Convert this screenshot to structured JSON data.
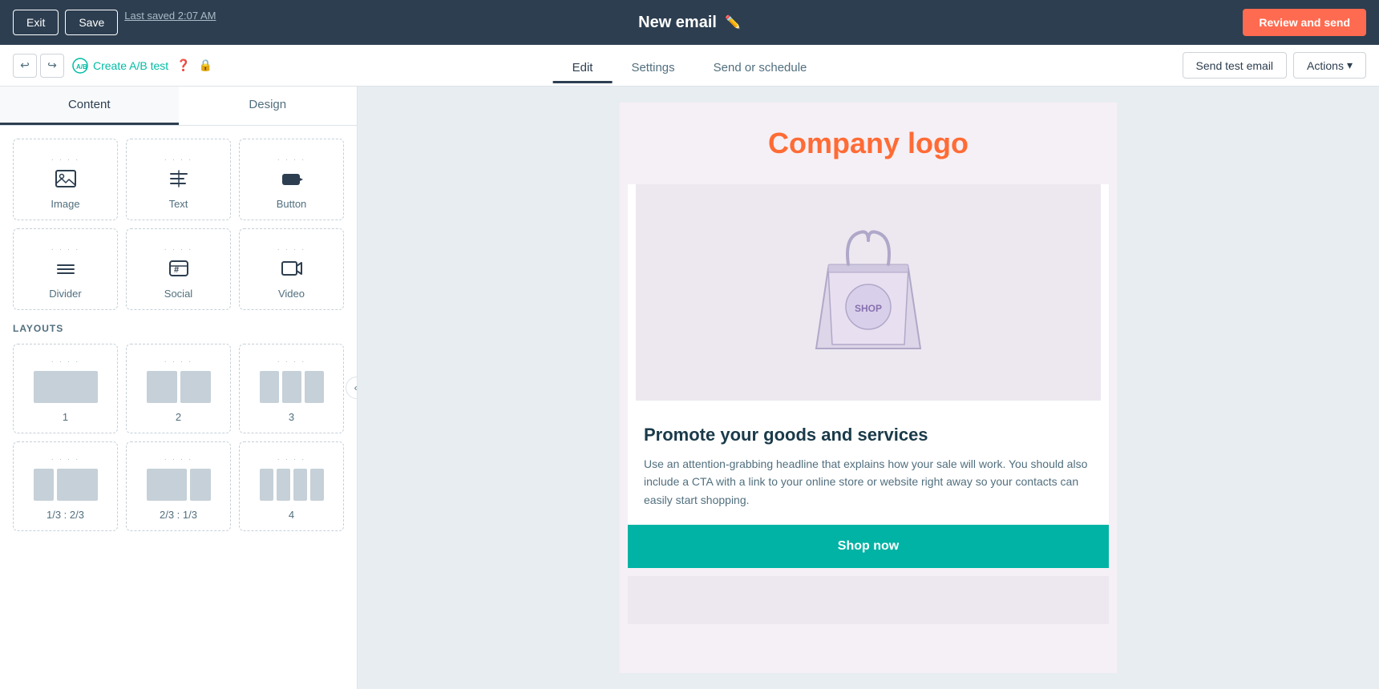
{
  "topbar": {
    "exit_label": "Exit",
    "save_label": "Save",
    "last_saved": "Last saved 2:07 AM",
    "email_title": "New email",
    "review_label": "Review and send"
  },
  "secondbar": {
    "ab_test_label": "Create A/B test",
    "tabs": [
      {
        "id": "edit",
        "label": "Edit",
        "active": true
      },
      {
        "id": "settings",
        "label": "Settings",
        "active": false
      },
      {
        "id": "send_schedule",
        "label": "Send or schedule",
        "active": false
      }
    ],
    "send_test_label": "Send test email",
    "actions_label": "Actions"
  },
  "sidebar": {
    "content_tab": "Content",
    "design_tab": "Design",
    "content_items": [
      {
        "id": "image",
        "label": "Image",
        "icon": "🖼"
      },
      {
        "id": "text",
        "label": "Text",
        "icon": "📝"
      },
      {
        "id": "button",
        "label": "Button",
        "icon": "🔲"
      },
      {
        "id": "divider",
        "label": "Divider",
        "icon": "➖"
      },
      {
        "id": "social",
        "label": "Social",
        "icon": "#️⃣"
      },
      {
        "id": "video",
        "label": "Video",
        "icon": "🎬"
      }
    ],
    "layouts_label": "LAYOUTS",
    "layouts": [
      {
        "id": "1",
        "label": "1",
        "cols": [
          1
        ]
      },
      {
        "id": "2",
        "label": "2",
        "cols": [
          1,
          1
        ]
      },
      {
        "id": "3",
        "label": "3",
        "cols": [
          1,
          1,
          1
        ]
      },
      {
        "id": "1_3_2_3",
        "label": "1/3 : 2/3",
        "cols": [
          1,
          2
        ]
      },
      {
        "id": "2_3_1_3",
        "label": "2/3 : 1/3",
        "cols": [
          2,
          1
        ]
      },
      {
        "id": "4",
        "label": "4",
        "cols": [
          1,
          1,
          1,
          1
        ]
      }
    ]
  },
  "canvas": {
    "company_logo": "Company logo",
    "promote_heading": "Promote your goods and services",
    "promote_body": "Use an attention-grabbing headline that explains how your sale will work. You should also include a CTA with a link to your online store or website right away so your contacts can easily start shopping.",
    "shop_now": "Shop now"
  }
}
